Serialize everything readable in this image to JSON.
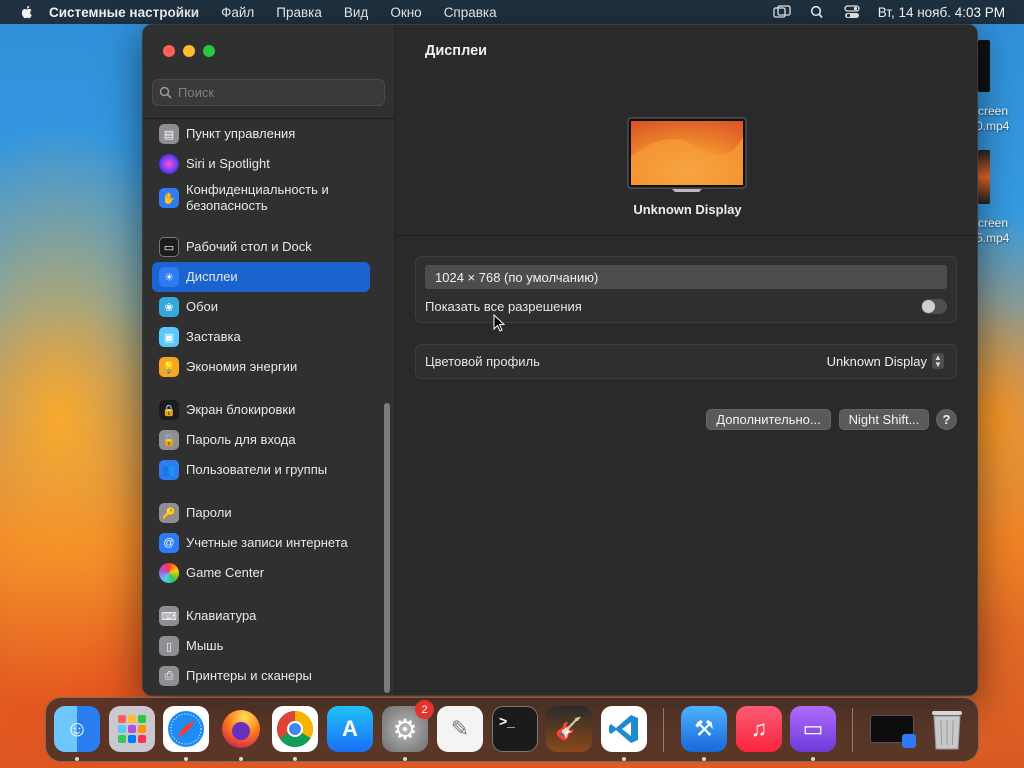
{
  "menubar": {
    "app_name": "Системные настройки",
    "menus": [
      "Файл",
      "Правка",
      "Вид",
      "Окно",
      "Справка"
    ],
    "clock": "Вт, 14 нояб.  4:03 PM"
  },
  "desktop": {
    "files": [
      {
        "line1": "creen",
        "line2": "0.mp4"
      },
      {
        "line1": "creen",
        "line2": "5.mp4"
      }
    ]
  },
  "sidebar": {
    "search_placeholder": "Поиск",
    "items": [
      {
        "label": "Пункт управления",
        "icon": "control-center-icon",
        "color": "#8e8e93"
      },
      {
        "label": "Siri и Spotlight",
        "icon": "siri-icon",
        "color": "#9b3dd1"
      },
      {
        "label": "Конфиденциальность и безопасность",
        "icon": "privacy-hand-icon",
        "color": "#2f7bf5"
      },
      {
        "label": "Рабочий стол и Dock",
        "icon": "desktop-dock-icon",
        "color": "#1c1c1e"
      },
      {
        "label": "Дисплеи",
        "icon": "displays-sun-icon",
        "color": "#2f7bf5"
      },
      {
        "label": "Обои",
        "icon": "wallpaper-flower-icon",
        "color": "#34aadc"
      },
      {
        "label": "Заставка",
        "icon": "screensaver-icon",
        "color": "#5ac8fa"
      },
      {
        "label": "Экономия энергии",
        "icon": "energy-bulb-icon",
        "color": "#f5a623"
      },
      {
        "label": "Экран блокировки",
        "icon": "lock-icon",
        "color": "#1c1c1e"
      },
      {
        "label": "Пароль для входа",
        "icon": "login-password-icon",
        "color": "#8e8e93"
      },
      {
        "label": "Пользователи и группы",
        "icon": "users-icon",
        "color": "#2f7bf5"
      },
      {
        "label": "Пароли",
        "icon": "key-icon",
        "color": "#8e8e93"
      },
      {
        "label": "Учетные записи интернета",
        "icon": "at-sign-icon",
        "color": "#2f7bf5"
      },
      {
        "label": "Game Center",
        "icon": "game-center-icon",
        "color": "#f2f2f2"
      },
      {
        "label": "Клавиатура",
        "icon": "keyboard-icon",
        "color": "#8e8e93"
      },
      {
        "label": "Мышь",
        "icon": "mouse-icon",
        "color": "#8e8e93"
      },
      {
        "label": "Принтеры и сканеры",
        "icon": "printer-icon",
        "color": "#8e8e93"
      }
    ],
    "active_index": 4
  },
  "content": {
    "title": "Дисплеи",
    "display_name": "Unknown Display",
    "resolution": "1024 × 768 (по умолчанию)",
    "show_all_label": "Показать все разрешения",
    "show_all_enabled": false,
    "color_profile_label": "Цветовой профиль",
    "color_profile_value": "Unknown Display",
    "advanced_button": "Дополнительно...",
    "night_shift_button": "Night Shift...",
    "help_button": "?"
  },
  "dock": {
    "apps": [
      {
        "name": "Finder",
        "icon": "finder-icon"
      },
      {
        "name": "Launchpad",
        "icon": "launchpad-icon"
      },
      {
        "name": "Safari",
        "icon": "safari-icon"
      },
      {
        "name": "Firefox",
        "icon": "firefox-icon"
      },
      {
        "name": "Chrome",
        "icon": "chrome-icon"
      },
      {
        "name": "App Store",
        "icon": "app-store-icon"
      },
      {
        "name": "System Settings",
        "icon": "system-settings-icon",
        "badge": "2"
      },
      {
        "name": "TextEdit",
        "icon": "textedit-icon"
      },
      {
        "name": "Terminal",
        "icon": "terminal-icon"
      },
      {
        "name": "GarageBand",
        "icon": "garageband-icon"
      },
      {
        "name": "Visual Studio Code",
        "icon": "vscode-icon"
      },
      {
        "name": "Xcode",
        "icon": "xcode-icon"
      },
      {
        "name": "Music",
        "icon": "music-icon"
      },
      {
        "name": "Podcast/App",
        "icon": "purple-app-icon"
      },
      {
        "name": "Downloads",
        "icon": "downloads-stack-icon"
      },
      {
        "name": "Trash",
        "icon": "trash-icon"
      }
    ]
  },
  "colors": {
    "accent": "#1b63cf",
    "window_bg": "#2a2a2a",
    "sidebar_bg": "#303030"
  }
}
